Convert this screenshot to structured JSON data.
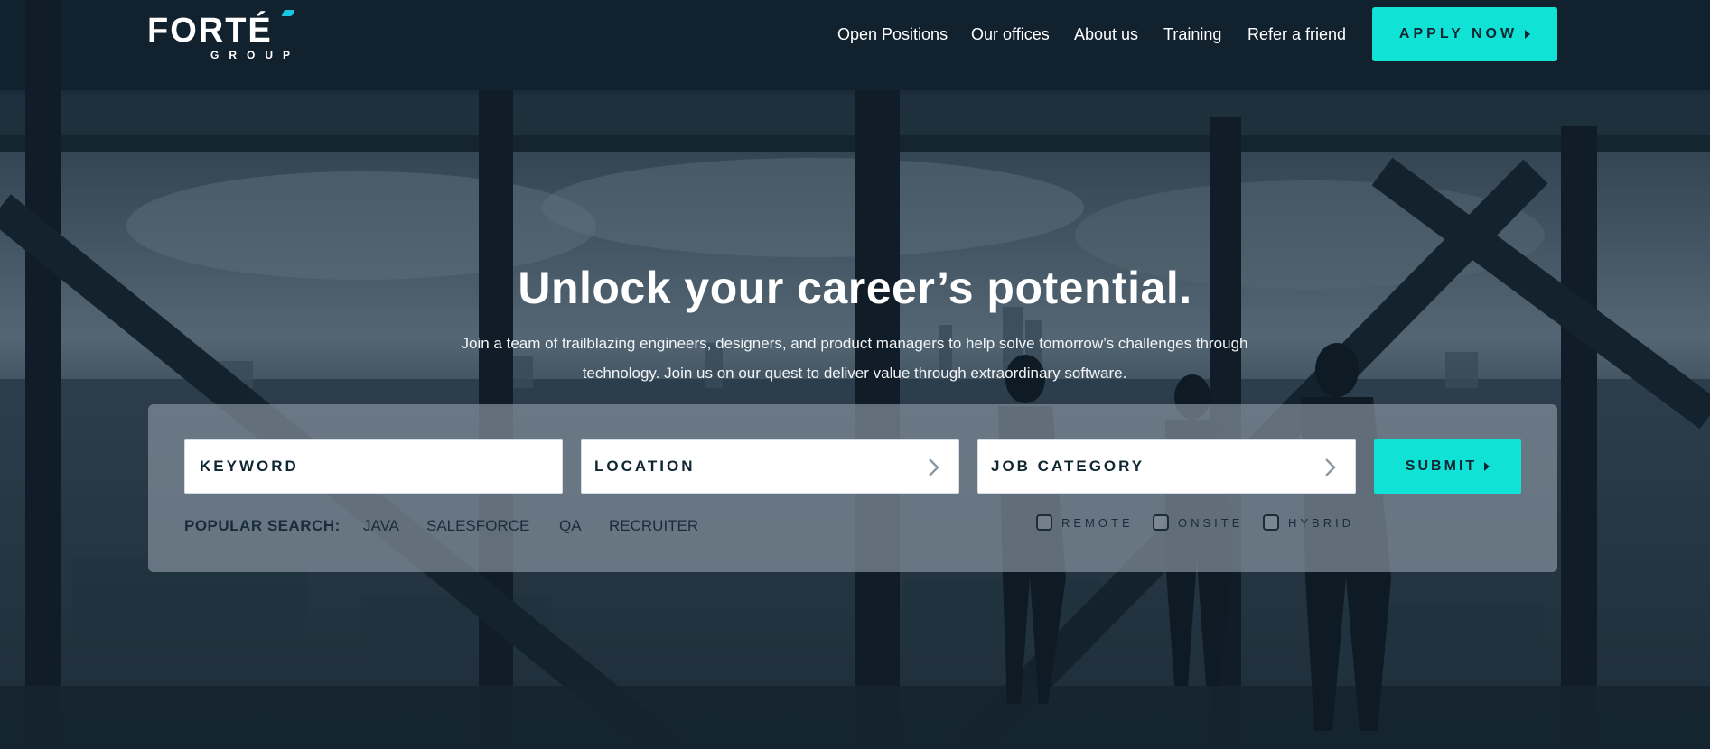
{
  "brand": {
    "logo_main": "FORTÉ",
    "logo_sub": "GROUP"
  },
  "nav": [
    {
      "label": "Open Positions"
    },
    {
      "label": "Our offices"
    },
    {
      "label": "About us"
    },
    {
      "label": "Training"
    },
    {
      "label": "Refer a friend"
    }
  ],
  "apply_button": {
    "label": "APPLY NOW"
  },
  "hero": {
    "title": "Unlock your career’s potential.",
    "subtitle": "Join a team of trailblazing engineers, designers, and product managers to help solve tomorrow’s challenges through technology. Join us on our quest to deliver value through extraordinary software."
  },
  "search": {
    "keyword_placeholder": "KEYWORD",
    "location_label": "LOCATION",
    "category_label": "JOB CATEGORY",
    "submit_label": "SUBMIT",
    "popular_label": "POPULAR SEARCH:",
    "popular_links": [
      "JAVA",
      "SALESFORCE",
      "QA",
      "RECRUITER"
    ],
    "work_types": [
      "REMOTE",
      "ONSITE",
      "HYBRID"
    ]
  },
  "colors": {
    "accent": "#10e3d6",
    "dark_text": "#0e2733",
    "overlay": "#1b2a38"
  }
}
